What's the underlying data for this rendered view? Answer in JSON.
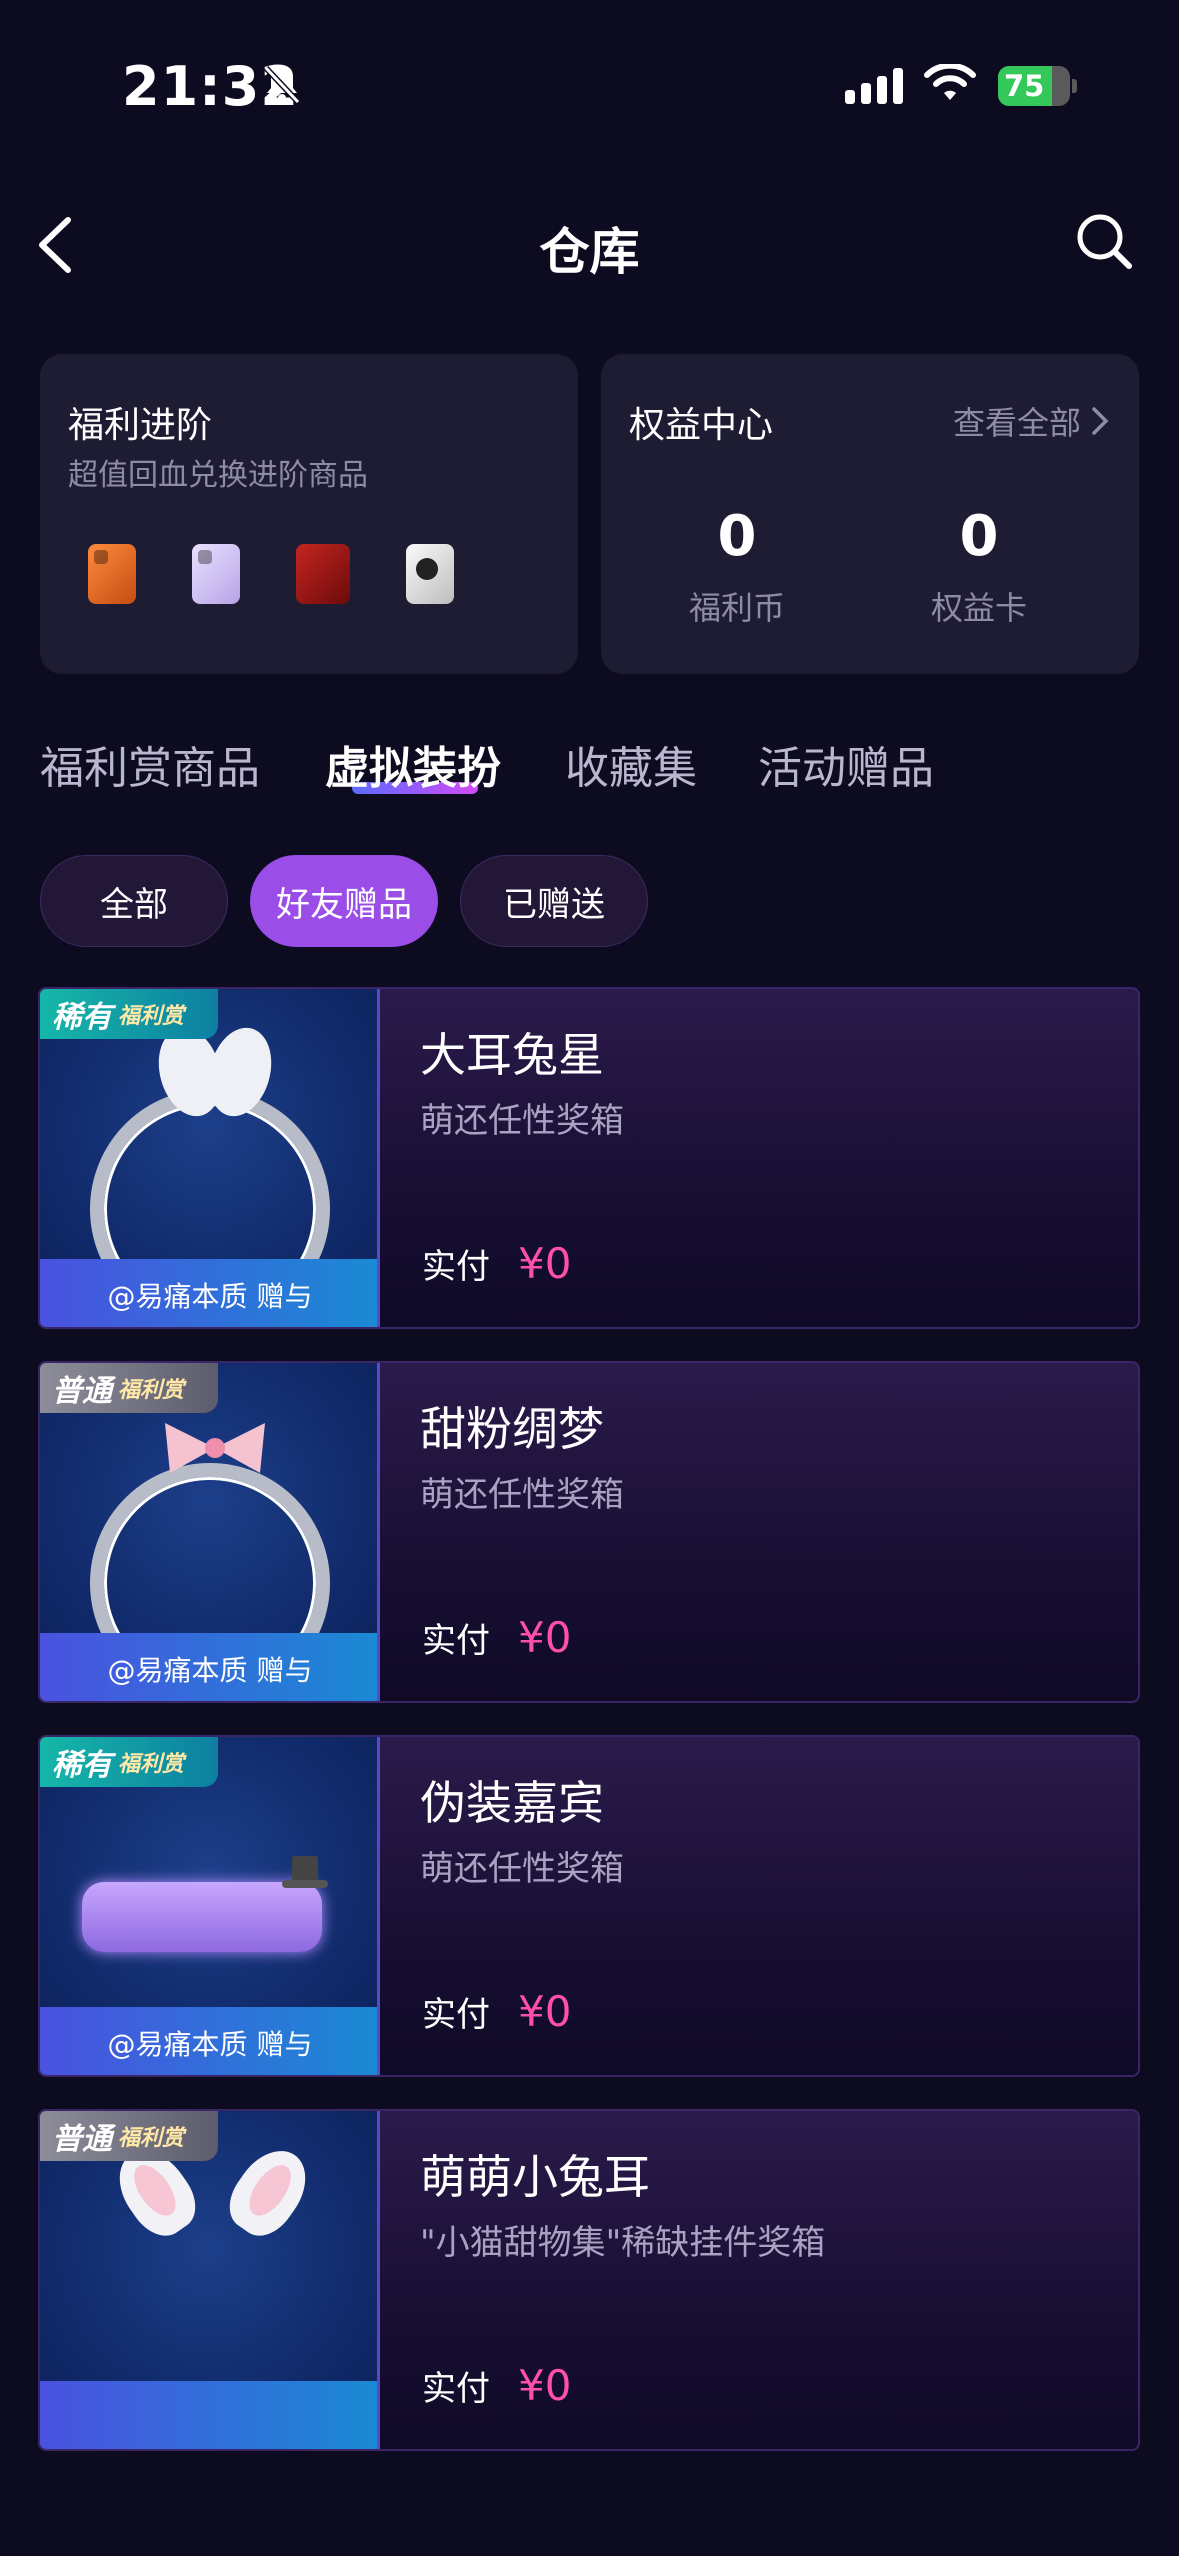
{
  "status_bar": {
    "time": "21:32",
    "battery": "75",
    "battery_level": 0.75
  },
  "nav": {
    "title": "仓库"
  },
  "welfare_card": {
    "title": "福利进阶",
    "subtitle": "超值回血兑换进阶商品"
  },
  "rights_card": {
    "title": "权益中心",
    "view_all": "查看全部",
    "stats": [
      {
        "value": "0",
        "label": "福利币"
      },
      {
        "value": "0",
        "label": "权益卡"
      }
    ]
  },
  "tabs": [
    "福利赏商品",
    "虚拟装扮",
    "收藏集",
    "活动赠品"
  ],
  "active_tab": "虚拟装扮",
  "filters": [
    "全部",
    "好友赠品",
    "已赠送"
  ],
  "active_filter": "好友赠品",
  "items": [
    {
      "badge": "稀有",
      "badge_sub": "福利赏",
      "name": "大耳兔星",
      "source": "萌还任性奖箱",
      "gift_from": "@易痛本质 赠与",
      "price_label": "实付",
      "price": "¥0"
    },
    {
      "badge": "普通",
      "badge_sub": "福利赏",
      "name": "甜粉绸梦",
      "source": "萌还任性奖箱",
      "gift_from": "@易痛本质 赠与",
      "price_label": "实付",
      "price": "¥0"
    },
    {
      "badge": "稀有",
      "badge_sub": "福利赏",
      "name": "伪装嘉宾",
      "source": "萌还任性奖箱",
      "gift_from": "@易痛本质 赠与",
      "price_label": "实付",
      "price": "¥0"
    },
    {
      "badge": "普通",
      "badge_sub": "福利赏",
      "name": "萌萌小兔耳",
      "source": "\"小猫甜物集\"稀缺挂件奖箱",
      "gift_from": "",
      "price_label": "实付",
      "price": "¥0"
    }
  ]
}
